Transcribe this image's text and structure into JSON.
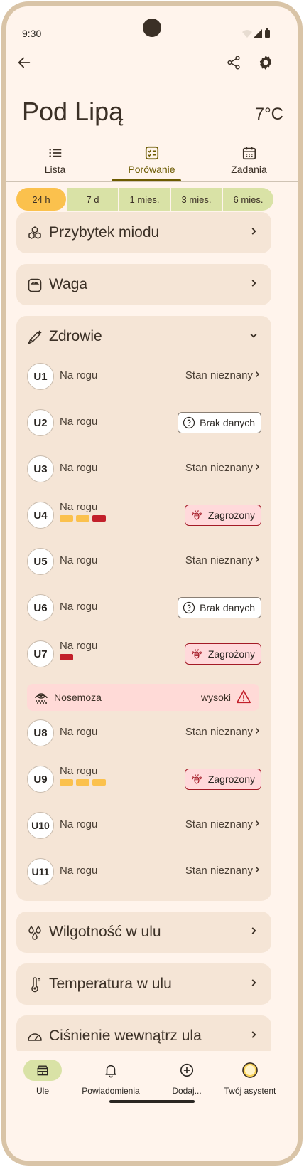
{
  "status_bar": {
    "time": "9:30"
  },
  "header": {
    "title": "Pod Lipą",
    "temperature": "7°C"
  },
  "tabs": [
    {
      "label": "Lista",
      "icon": "list-icon",
      "active": false
    },
    {
      "label": "Porówanie",
      "icon": "checklist-icon",
      "active": true
    },
    {
      "label": "Zadania",
      "icon": "calendar-icon",
      "active": false
    }
  ],
  "time_ranges": [
    "24 h",
    "7 d",
    "1 mies.",
    "3 mies.",
    "6 mies."
  ],
  "active_range": "24 h",
  "sections": {
    "honey": {
      "title": "Przybytek miodu",
      "icon": "honeycomb-icon"
    },
    "weight": {
      "title": "Waga",
      "icon": "scale-icon"
    },
    "health": {
      "title": "Zdrowie",
      "icon": "syringe-icon"
    },
    "humidity": {
      "title": "Wilgotność w ulu",
      "icon": "droplets-icon"
    },
    "temperature": {
      "title": "Temperatura w ulu",
      "icon": "thermometer-icon"
    },
    "pressure": {
      "title": "Ciśnienie wewnątrz ula",
      "icon": "gauge-icon"
    }
  },
  "health_rows": [
    {
      "hive": "U1",
      "location": "Na rogu",
      "status": "Stan nieznany"
    },
    {
      "hive": "U2",
      "location": "Na rogu",
      "status": "Brak danych"
    },
    {
      "hive": "U3",
      "location": "Na rogu",
      "status": "Stan nieznany"
    },
    {
      "hive": "U4",
      "location": "Na rogu",
      "status": "Zagrożony"
    },
    {
      "hive": "U5",
      "location": "Na rogu",
      "status": "Stan nieznany"
    },
    {
      "hive": "U6",
      "location": "Na rogu",
      "status": "Brak danych"
    },
    {
      "hive": "U7",
      "location": "Na rogu",
      "status": "Zagrożony"
    },
    {
      "hive": "U8",
      "location": "Na rogu",
      "status": "Stan nieznany"
    },
    {
      "hive": "U9",
      "location": "Na rogu",
      "status": "Zagrożony"
    },
    {
      "hive": "U10",
      "location": "Na rogu",
      "status": "Stan nieznany"
    },
    {
      "hive": "U11",
      "location": "Na rogu",
      "status": "Stan nieznany"
    }
  ],
  "alert": {
    "label": "Nosemoza",
    "level": "wysoki"
  },
  "colors": {
    "warning_yellow": "#fbc14d",
    "danger_red": "#c2202b",
    "accent": "#6c5a00",
    "chip_green": "#d9e2a6"
  },
  "bottom_nav": [
    {
      "label": "Ule",
      "icon": "hive-icon",
      "active": true
    },
    {
      "label": "Powiadomienia",
      "icon": "bell-icon",
      "active": false
    },
    {
      "label": "Dodaj...",
      "icon": "add-circle-icon",
      "active": false
    },
    {
      "label": "Twój asystent",
      "icon": "assistant-icon",
      "active": false
    }
  ]
}
